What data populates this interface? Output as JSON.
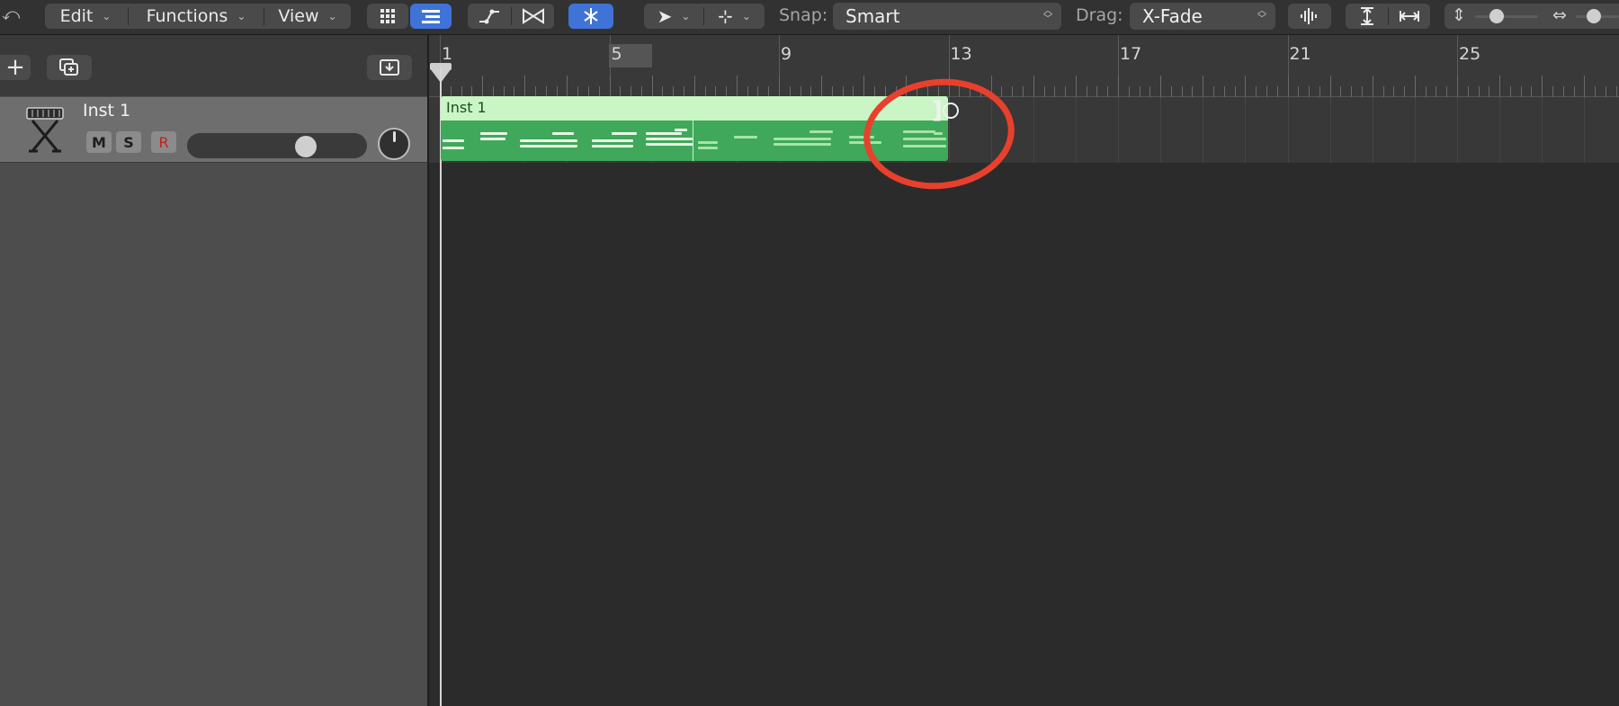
{
  "toolbar": {
    "back_glyph": "⤺",
    "menus": [
      {
        "label": "Edit"
      },
      {
        "label": "Functions"
      },
      {
        "label": "View"
      }
    ],
    "snap_label": "Snap:",
    "snap_value": "Smart",
    "drag_label": "Drag:",
    "drag_value": "X-Fade",
    "accent_color": "#3f73d8"
  },
  "track_list": {
    "add_button": "+",
    "tracks": [
      {
        "name": "Inst 1",
        "mute": "M",
        "solo": "S",
        "record": "R",
        "volume_level": 0.68
      }
    ]
  },
  "ruler": {
    "bar_numbers": [
      "1",
      "5",
      "9",
      "13",
      "17",
      "21",
      "25"
    ]
  },
  "region": {
    "name": "Inst 1",
    "color": "#3fa85a"
  },
  "annotation": {
    "color": "#e8402c"
  }
}
